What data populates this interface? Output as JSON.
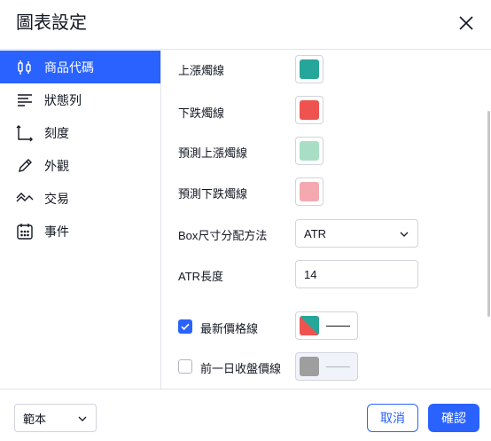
{
  "dialog": {
    "title": "圖表設定"
  },
  "sidebar": {
    "items": [
      {
        "label": "商品代碼",
        "icon": "candles-icon",
        "active": true
      },
      {
        "label": "狀態列",
        "icon": "status-line-icon"
      },
      {
        "label": "刻度",
        "icon": "scales-icon"
      },
      {
        "label": "外觀",
        "icon": "pencil-icon"
      },
      {
        "label": "交易",
        "icon": "trading-icon"
      },
      {
        "label": "事件",
        "icon": "calendar-icon"
      }
    ]
  },
  "symbol": {
    "up_candle_label": "上漲燭線",
    "up_candle_color": "#26a69a",
    "down_candle_label": "下跌燭線",
    "down_candle_color": "#ef5350",
    "proj_up_label": "預測上漲燭線",
    "proj_up_color": "#a8dfc4",
    "proj_down_label": "預測下跌燭線",
    "proj_down_color": "#f4a9b1",
    "box_label": "Box尺寸分配方法",
    "box_value": "ATR",
    "atr_label": "ATR長度",
    "atr_value": "14",
    "last_price_label": "最新價格線",
    "last_price_checked": true,
    "prev_close_label": "前一日收盤價線",
    "prev_close_checked": false
  },
  "footer": {
    "template_label": "範本",
    "cancel_label": "取消",
    "ok_label": "確認"
  },
  "colors": {
    "accent": "#2962ff"
  }
}
